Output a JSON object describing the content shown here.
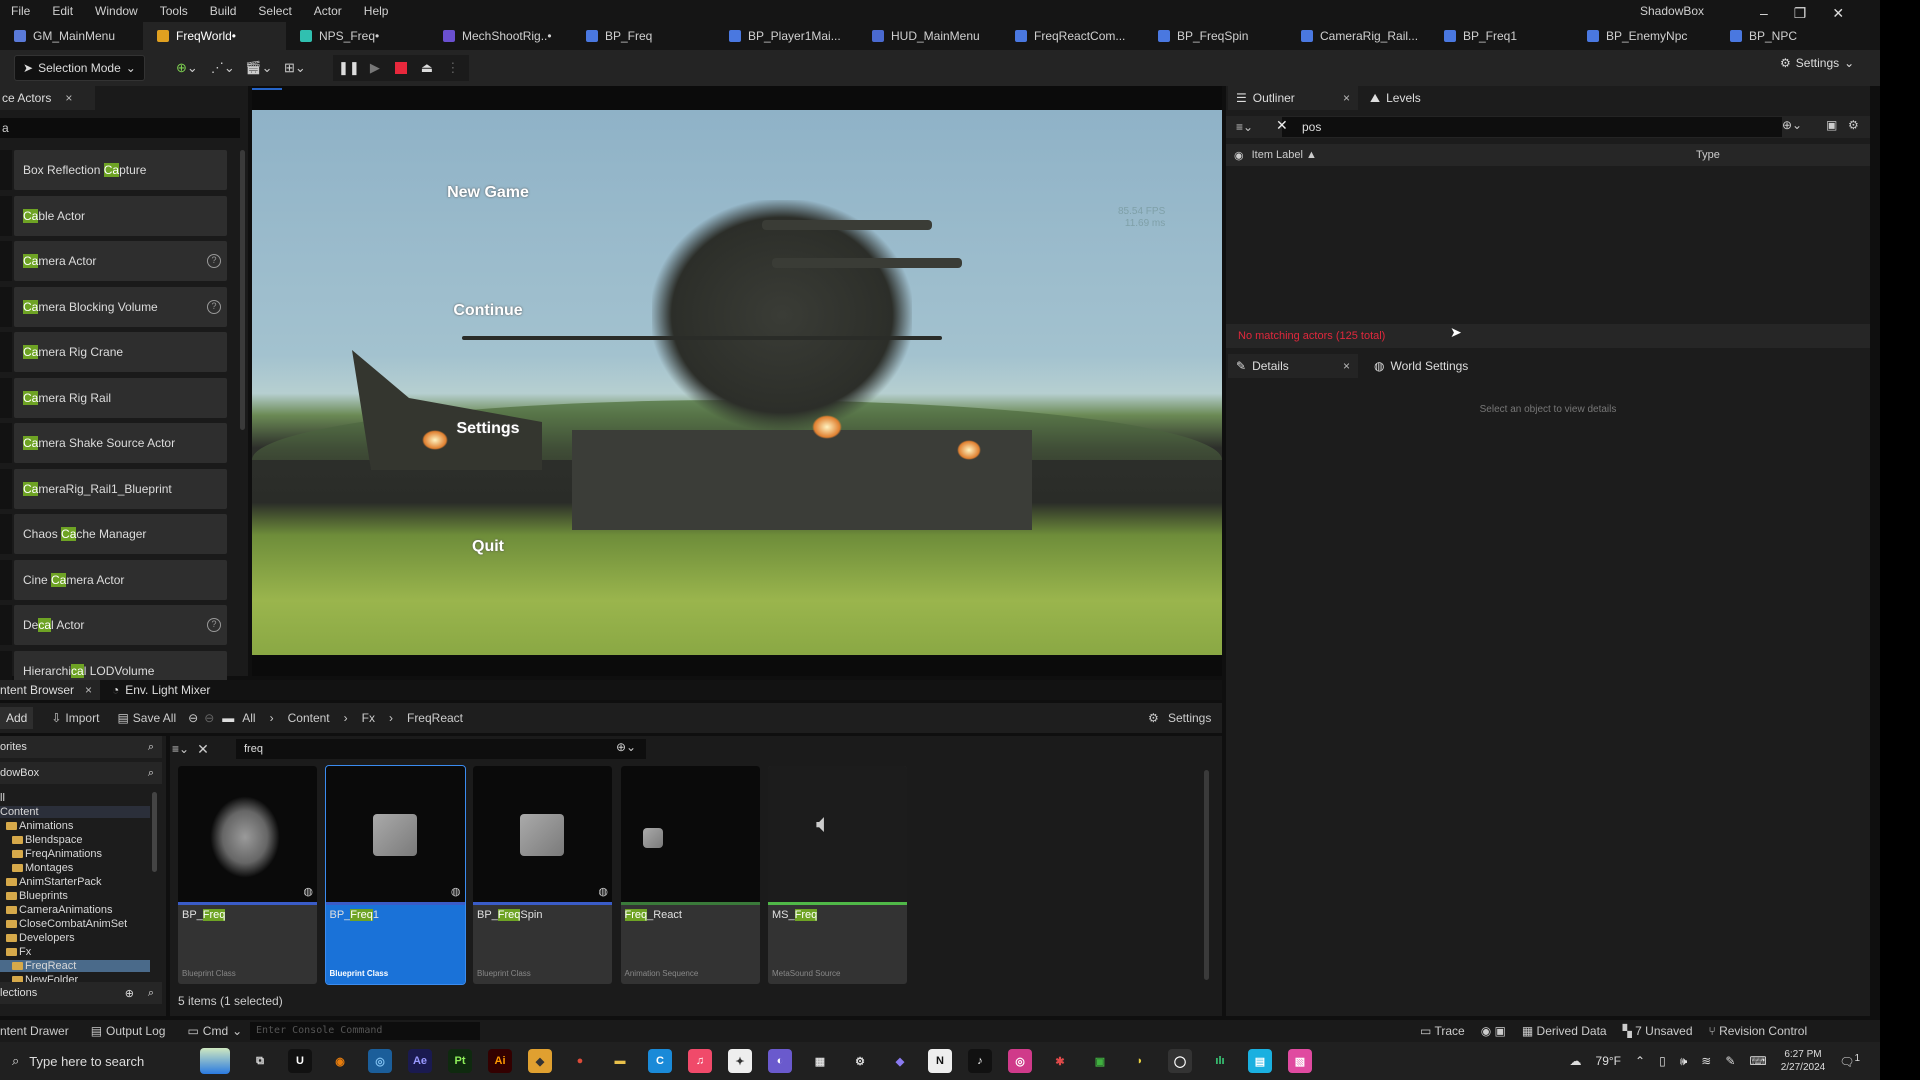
{
  "menu": [
    "File",
    "Edit",
    "Window",
    "Tools",
    "Build",
    "Select",
    "Actor",
    "Help"
  ],
  "app_title": "ShadowBox",
  "doc_tabs": [
    {
      "label": "GM_MainMenu",
      "icon": "game-mode-icon",
      "color": "#5a7ad8"
    },
    {
      "label": "FreqWorld•",
      "icon": "level-icon",
      "color": "#e0a020",
      "active": true
    },
    {
      "label": "NPS_Freq•",
      "icon": "niagara-icon",
      "color": "#30c0b0"
    },
    {
      "label": "MechShootRig..•",
      "icon": "control-rig-icon",
      "color": "#6a50d0"
    },
    {
      "label": "BP_Freq",
      "icon": "blueprint-icon",
      "color": "#4a78e0"
    },
    {
      "label": "BP_Player1Mai...",
      "icon": "character-icon",
      "color": "#4a78e0"
    },
    {
      "label": "HUD_MainMenu",
      "icon": "widget-icon",
      "color": "#4a6ad0"
    },
    {
      "label": "FreqReactCom...",
      "icon": "component-icon",
      "color": "#4a78e0"
    },
    {
      "label": "BP_FreqSpin",
      "icon": "blueprint-icon",
      "color": "#4a78e0"
    },
    {
      "label": "CameraRig_Rail...",
      "icon": "blueprint-icon",
      "color": "#4a78e0"
    },
    {
      "label": "BP_Freq1",
      "icon": "blueprint-icon",
      "color": "#4a78e0"
    },
    {
      "label": "BP_EnemyNpc",
      "icon": "character-icon",
      "color": "#4a78e0"
    },
    {
      "label": "BP_NPC",
      "icon": "character-icon",
      "color": "#4a78e0"
    }
  ],
  "toolbar": {
    "selection_mode": "Selection Mode",
    "settings": "Settings"
  },
  "place_actors": {
    "tab_label": "ce Actors",
    "search_value": "a",
    "items": [
      {
        "pre": "Box Reflection ",
        "hl": "Ca",
        "post": "pture",
        "help": false
      },
      {
        "pre": "",
        "hl": "Ca",
        "post": "ble Actor",
        "help": false
      },
      {
        "pre": "",
        "hl": "Ca",
        "post": "mera Actor",
        "help": true
      },
      {
        "pre": "",
        "hl": "Ca",
        "post": "mera Blocking Volume",
        "help": true
      },
      {
        "pre": "",
        "hl": "Ca",
        "post": "mera Rig Crane",
        "help": false
      },
      {
        "pre": "",
        "hl": "Ca",
        "post": "mera Rig Rail",
        "help": false
      },
      {
        "pre": "",
        "hl": "Ca",
        "post": "mera Shake Source Actor",
        "help": false
      },
      {
        "pre": "",
        "hl": "Ca",
        "post": "meraRig_Rail1_Blueprint",
        "help": false
      },
      {
        "pre": "Chaos ",
        "hl": "Ca",
        "post": "che Manager",
        "help": false
      },
      {
        "pre": "Cine ",
        "hl": "Ca",
        "post": "mera Actor",
        "help": false
      },
      {
        "pre": "De",
        "hl": "ca",
        "post": "l Actor",
        "help": true
      },
      {
        "pre": "Hierarchi",
        "hl": "ca",
        "post": "l LODVolume",
        "help": false
      }
    ]
  },
  "viewport": {
    "menu_items": [
      "New Game",
      "Continue",
      "Settings",
      "Quit"
    ],
    "fps": "85.54 FPS",
    "ms": "11.69 ms"
  },
  "outliner": {
    "tab": "Outliner",
    "tab2": "Levels",
    "search_value": "pos",
    "col_label": "Item Label ▲",
    "col_type": "Type",
    "status": "No matching actors (125 total)"
  },
  "details": {
    "tab": "Details",
    "tab2": "World Settings",
    "empty": "Select an object to view details"
  },
  "content_browser": {
    "tab": "ntent Browser",
    "tab2": "Env. Light Mixer",
    "add": "Add",
    "import": "Import",
    "save_all": "Save All",
    "breadcrumb": [
      "All",
      "Content",
      "Fx",
      "FreqReact"
    ],
    "settings": "Settings",
    "favorites": "orites",
    "project": "dowBox",
    "tree": [
      {
        "label": "ll",
        "depth": 0,
        "folder": false
      },
      {
        "label": "Content",
        "depth": 0,
        "folder": false
      },
      {
        "label": "Animations",
        "depth": 1,
        "folder": true
      },
      {
        "label": "Blendspace",
        "depth": 2,
        "folder": true
      },
      {
        "label": "FreqAnimations",
        "depth": 2,
        "folder": true
      },
      {
        "label": "Montages",
        "depth": 2,
        "folder": true
      },
      {
        "label": "AnimStarterPack",
        "depth": 1,
        "folder": true
      },
      {
        "label": "Blueprints",
        "depth": 1,
        "folder": true
      },
      {
        "label": "CameraAnimations",
        "depth": 1,
        "folder": true
      },
      {
        "label": "CloseCombatAnimSet",
        "depth": 1,
        "folder": true
      },
      {
        "label": "Developers",
        "depth": 1,
        "folder": true
      },
      {
        "label": "Fx",
        "depth": 1,
        "folder": true
      },
      {
        "label": "FreqReact",
        "depth": 2,
        "folder": true,
        "selected": true
      },
      {
        "label": "NewFolder",
        "depth": 2,
        "folder": true
      }
    ],
    "collections": "lections",
    "filter_value": "freq",
    "assets": [
      {
        "pre": "BP_",
        "hl": "Freq",
        "post": "",
        "type": "Blueprint Class",
        "bar": "#3a5cc8",
        "thumb": "mech"
      },
      {
        "pre": "BP_",
        "hl": "Freq",
        "post": "1",
        "type": "Blueprint Class",
        "bar": "#3a5cc8",
        "thumb": "cube",
        "selected": true
      },
      {
        "pre": "BP_",
        "hl": "Freq",
        "post": "Spin",
        "type": "Blueprint Class",
        "bar": "#3a5cc8",
        "thumb": "cube"
      },
      {
        "pre": "",
        "hl": "Freq",
        "post": "_React",
        "type": "Animation Sequence",
        "bar": "#3a7a3a",
        "thumb": "smallcube"
      },
      {
        "pre": "MS_",
        "hl": "Freq",
        "post": "",
        "type": "MetaSound Source",
        "bar": "#50b848",
        "thumb": "sound"
      }
    ],
    "count": "5 items (1 selected)"
  },
  "statusbar": {
    "content_drawer": "ntent Drawer",
    "output_log": "Output Log",
    "cmd": "Cmd",
    "console_placeholder": "Enter Console Command",
    "trace": "Trace",
    "derived_data": "Derived Data",
    "unsaved": "7 Unsaved",
    "revision": "Revision Control"
  },
  "taskbar": {
    "search": "Type here to search",
    "apps": [
      {
        "name": "task-view",
        "label": "⧉",
        "bg": "transparent",
        "fg": "#ddd"
      },
      {
        "name": "unreal",
        "label": "U",
        "bg": "#111",
        "fg": "#fff"
      },
      {
        "name": "blender",
        "label": "◉",
        "bg": "transparent",
        "fg": "#e87d0d"
      },
      {
        "name": "app-globe",
        "label": "◎",
        "bg": "#1b5e9a",
        "fg": "#7fc0f0"
      },
      {
        "name": "after-effects",
        "label": "Ae",
        "bg": "#1a1a50",
        "fg": "#9999ff"
      },
      {
        "name": "painter",
        "label": "Pt",
        "bg": "#0f2a0f",
        "fg": "#8ef05a"
      },
      {
        "name": "illustrator",
        "label": "Ai",
        "bg": "#330000",
        "fg": "#ff9a00"
      },
      {
        "name": "app-orange",
        "label": "◆",
        "bg": "#e0a030",
        "fg": "#333"
      },
      {
        "name": "chrome",
        "label": "●",
        "bg": "transparent",
        "fg": "#dd4b39"
      },
      {
        "name": "file-explorer",
        "label": "▬",
        "bg": "transparent",
        "fg": "#e8c04a"
      },
      {
        "name": "app-blue",
        "label": "C",
        "bg": "#1a8ad8",
        "fg": "#fff"
      },
      {
        "name": "itunes",
        "label": "♫",
        "bg": "#f04a6a",
        "fg": "#fff"
      },
      {
        "name": "app-white",
        "label": "✦",
        "bg": "#eee",
        "fg": "#333"
      },
      {
        "name": "discord",
        "label": "◐",
        "bg": "#6a5acd",
        "fg": "#fff"
      },
      {
        "name": "app-grid",
        "label": "▦",
        "bg": "transparent",
        "fg": "#ddd"
      },
      {
        "name": "app-gear",
        "label": "⚙",
        "bg": "transparent",
        "fg": "#ddd"
      },
      {
        "name": "app-purple",
        "label": "◆",
        "bg": "transparent",
        "fg": "#8a7af0"
      },
      {
        "name": "notion",
        "label": "N",
        "bg": "#eee",
        "fg": "#111"
      },
      {
        "name": "tiktok",
        "label": "♪",
        "bg": "#111",
        "fg": "#fff"
      },
      {
        "name": "instagram",
        "label": "◎",
        "bg": "#d03a8a",
        "fg": "#fff"
      },
      {
        "name": "app-dark",
        "label": "✱",
        "bg": "transparent",
        "fg": "#e04a4a"
      },
      {
        "name": "app-multi",
        "label": "▣",
        "bg": "transparent",
        "fg": "#40b040"
      },
      {
        "name": "app-yellow",
        "label": "◗",
        "bg": "transparent",
        "fg": "#e8d040"
      },
      {
        "name": "obs",
        "label": "◯",
        "bg": "#333",
        "fg": "#fff"
      },
      {
        "name": "audio",
        "label": "ılı",
        "bg": "transparent",
        "fg": "#3ad07a"
      },
      {
        "name": "app-cyan",
        "label": "▤",
        "bg": "#1ab0e0",
        "fg": "#fff"
      },
      {
        "name": "app-pink",
        "label": "▧",
        "bg": "#e04aa0",
        "fg": "#fff"
      }
    ],
    "weather": "79°F",
    "time": "6:27 PM",
    "date": "2/27/2024",
    "notifications": "1"
  }
}
